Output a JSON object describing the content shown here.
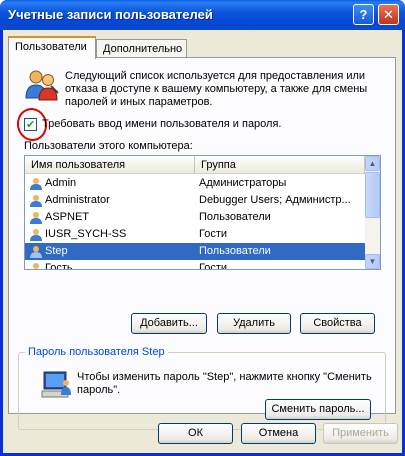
{
  "window": {
    "title": "Учетные записи пользователей",
    "help_glyph": "?",
    "close_glyph": "✕"
  },
  "tabs": [
    {
      "label": "Пользователи",
      "active": true
    },
    {
      "label": "Дополнительно",
      "active": false
    }
  ],
  "description": "Следующий список используется для предоставления или отказа в доступе к вашему компьютеру, а также для смены паролей и иных параметров.",
  "require_login": {
    "label": "Требовать ввод имени пользователя и пароля.",
    "checked": true
  },
  "list_label": "Пользователи этого компьютера:",
  "users_list": {
    "columns": [
      "Имя пользователя",
      "Группа"
    ],
    "rows": [
      {
        "name": "Admin",
        "group": "Администраторы",
        "selected": false
      },
      {
        "name": "Administrator",
        "group": "Debugger Users; Администр...",
        "selected": false
      },
      {
        "name": "ASPNET",
        "group": "Пользователи",
        "selected": false
      },
      {
        "name": "IUSR_SYCH-SS",
        "group": "Гости",
        "selected": false
      },
      {
        "name": "Step",
        "group": "Пользователи",
        "selected": true
      },
      {
        "name": "Гость",
        "group": "Гости",
        "selected": false
      }
    ]
  },
  "list_buttons": {
    "add": "Добавить...",
    "remove": "Удалить",
    "properties": "Свойства"
  },
  "password_group": {
    "title": "Пароль пользователя Step",
    "text": "Чтобы изменить пароль \"Step\", нажмите кнопку \"Сменить пароль\".",
    "button": "Сменить пароль..."
  },
  "dialog_buttons": {
    "ok": "ОК",
    "cancel": "Отмена",
    "apply": "Применить"
  },
  "colors": {
    "titlebar": "#0b58dd",
    "selection": "#316ac5",
    "annotation_circle": "#e00000"
  }
}
